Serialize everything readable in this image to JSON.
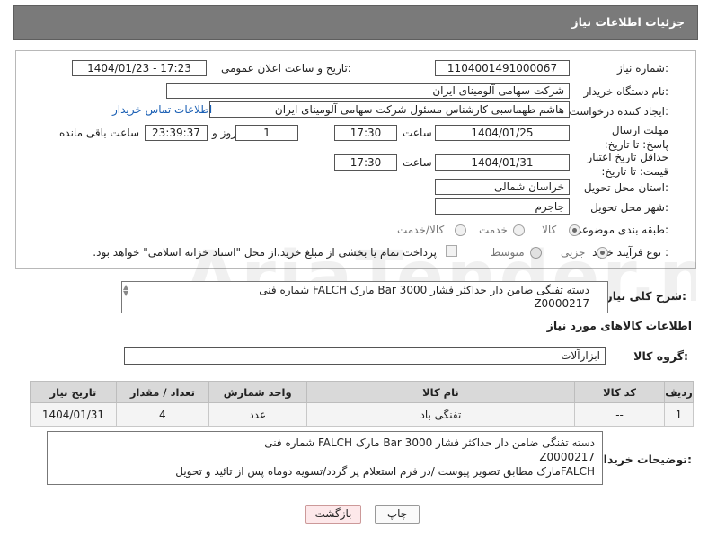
{
  "header": {
    "title": "جزئیات اطلاعات نیاز"
  },
  "form": {
    "need_number_label": "شماره نیاز:",
    "need_number": "1104001491000067",
    "announce_label": "تاریخ و ساعت اعلان عمومی:",
    "announce_value": "1404/01/23 - 17:23",
    "buyer_org_label": "نام دستگاه خریدار:",
    "buyer_org": "شرکت سهامی آلومینای ایران",
    "requester_label": "ایجاد کننده درخواست:",
    "requester": "هاشم طهماسبی کارشناس مسئول شرکت سهامی آلومینای ایران",
    "contact_link": "اطلاعات تماس خریدار",
    "reply_deadline_label": "مهلت ارسال پاسخ: تا تاریخ:",
    "reply_date": "1404/01/25",
    "time_label": "ساعت",
    "reply_time": "17:30",
    "days_value": "1",
    "days_label": "روز و",
    "remaining_time": "23:39:37",
    "remaining_label": "ساعت باقی مانده",
    "price_validity_label": "حداقل تاریخ اعتبار قیمت: تا تاریخ:",
    "validity_date": "1404/01/31",
    "validity_time": "17:30",
    "province_label": "استان محل تحویل:",
    "province": "خراسان شمالی",
    "city_label": "شهر محل تحویل:",
    "city": "جاجرم",
    "category_label": "طبقه بندی موضوعی:",
    "category_options": [
      "کالا",
      "خدمت",
      "کالا/خدمت"
    ],
    "process_label": "نوع فرآیند خرید :",
    "process_options": [
      "جزیی",
      "متوسط"
    ],
    "payment_note": "پرداخت تمام یا بخشی از مبلغ خرید،از محل \"اسناد خزانه اسلامی\" خواهد بود."
  },
  "description": {
    "label": "شرح کلی نیاز:",
    "text_line1": "دسته تفنگی ضامن دار حداکثر فشار Bar 3000 مارک FALCH شماره فنی",
    "text_line2": "Z0000217"
  },
  "goods": {
    "section_title": "اطلاعات کالاهای مورد نیاز",
    "group_label": "گروه کالا:",
    "group_value": "ابزارآلات",
    "columns": [
      "ردیف",
      "کد کالا",
      "نام کالا",
      "واحد شمارش",
      "تعداد / مقدار",
      "تاریخ نیاز"
    ],
    "rows": [
      {
        "row": "1",
        "code": "--",
        "name": "تفنگی باد",
        "unit": "عدد",
        "qty": "4",
        "date": "1404/01/31"
      }
    ]
  },
  "buyer_notes": {
    "label": "توضیحات خریدار:",
    "line1": "دسته تفنگی ضامن دار حداکثر فشار Bar 3000 مارک FALCH شماره فنی",
    "line2": "Z0000217",
    "line3": "FALCHمارک مطابق تصویر پیوست /در فرم استعلام پر گردد/تسویه دوماه پس از تائید و تحویل"
  },
  "buttons": {
    "print": "چاپ",
    "back": "بازگشت"
  },
  "colors": {
    "header_bg": "#7a7a7a",
    "link": "#1a5fb4",
    "back_button_bg": "#fde8ea"
  }
}
